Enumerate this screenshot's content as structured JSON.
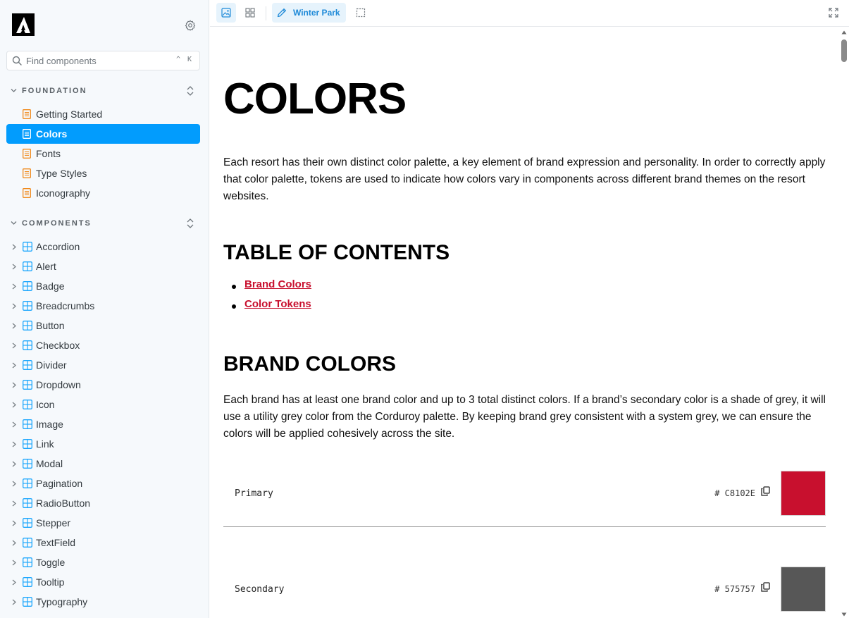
{
  "sidebar": {
    "search": {
      "placeholder": "Find components",
      "shortcut": "^ K"
    },
    "sections": [
      {
        "title": "FOUNDATION",
        "items": [
          {
            "label": "Getting Started"
          },
          {
            "label": "Colors"
          },
          {
            "label": "Fonts"
          },
          {
            "label": "Type Styles"
          },
          {
            "label": "Iconography"
          }
        ]
      },
      {
        "title": "COMPONENTS",
        "items": [
          {
            "label": "Accordion"
          },
          {
            "label": "Alert"
          },
          {
            "label": "Badge"
          },
          {
            "label": "Breadcrumbs"
          },
          {
            "label": "Button"
          },
          {
            "label": "Checkbox"
          },
          {
            "label": "Divider"
          },
          {
            "label": "Dropdown"
          },
          {
            "label": "Icon"
          },
          {
            "label": "Image"
          },
          {
            "label": "Link"
          },
          {
            "label": "Modal"
          },
          {
            "label": "Pagination"
          },
          {
            "label": "RadioButton"
          },
          {
            "label": "Stepper"
          },
          {
            "label": "TextField"
          },
          {
            "label": "Toggle"
          },
          {
            "label": "Tooltip"
          },
          {
            "label": "Typography"
          }
        ]
      }
    ]
  },
  "toolbar": {
    "theme_label": "Winter Park"
  },
  "content": {
    "title": "COLORS",
    "intro": "Each resort has their own distinct color palette, a key element of brand expression and personality. In order to correctly apply that color palette, tokens are used to indicate how colors vary in components across different brand themes on the resort websites.",
    "toc_heading": "TABLE OF CONTENTS",
    "toc_links": [
      "Brand Colors",
      "Color Tokens"
    ],
    "brand_heading": "BRAND COLORS",
    "brand_text": "Each brand has at least one brand color and up to 3 total distinct colors. If a brand’s secondary color is a shade of grey, it will use a utility grey color from the Corduroy palette. By keeping brand grey consistent with a system grey, we can ensure the colors will be applied cohesively across the site.",
    "swatches": [
      {
        "name": "Primary",
        "hex_label": "# C8102E",
        "color": "#C8102E"
      },
      {
        "name": "Secondary",
        "hex_label": "# 575757",
        "color": "#575757"
      }
    ]
  },
  "colors": {
    "accent": "#029cfd",
    "link": "#c8102e",
    "doc_icon": "#f08b1e",
    "component_icon": "#1ea7fd"
  }
}
